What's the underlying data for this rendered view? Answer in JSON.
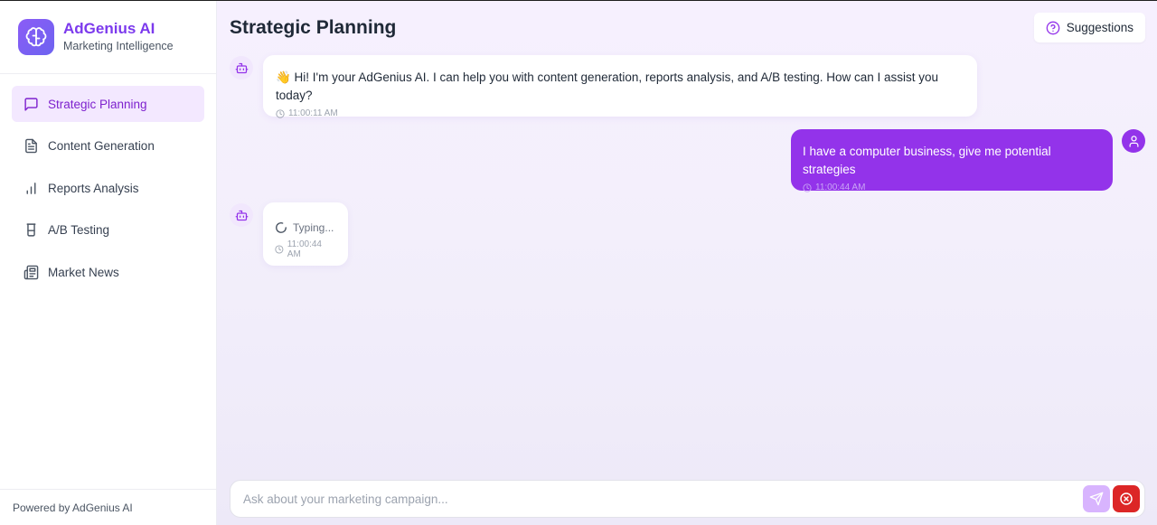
{
  "brand": {
    "name": "AdGenius AI",
    "tagline": "Marketing Intelligence",
    "logo_icon": "brain-icon"
  },
  "sidebar": {
    "items": [
      {
        "label": "Strategic Planning",
        "icon": "message-square-icon",
        "active": true
      },
      {
        "label": "Content Generation",
        "icon": "file-text-icon",
        "active": false
      },
      {
        "label": "Reports Analysis",
        "icon": "bar-chart-icon",
        "active": false
      },
      {
        "label": "A/B Testing",
        "icon": "beaker-icon",
        "active": false
      },
      {
        "label": "Market News",
        "icon": "newspaper-icon",
        "active": false
      }
    ],
    "footer": "Powered by AdGenius AI"
  },
  "header": {
    "title": "Strategic Planning",
    "suggestions_label": "Suggestions"
  },
  "messages": [
    {
      "role": "bot",
      "text": "👋 Hi! I'm your AdGenius AI. I can help you with content generation, reports analysis, and A/B testing. How can I assist you today?",
      "time": "11:00:11 AM"
    },
    {
      "role": "user",
      "text": "I have a computer business, give me potential strategies",
      "time": "11:00:44 AM"
    },
    {
      "role": "bot",
      "text": "Typing...",
      "time": "11:00:44 AM",
      "typing": true
    }
  ],
  "input": {
    "placeholder": "Ask about your marketing campaign...",
    "value": ""
  },
  "colors": {
    "accent": "#9333ea",
    "accent_light": "#f3e8ff",
    "brand_text": "#7c3aed",
    "stop": "#dc2626",
    "send_disabled": "#d8b4fe"
  }
}
